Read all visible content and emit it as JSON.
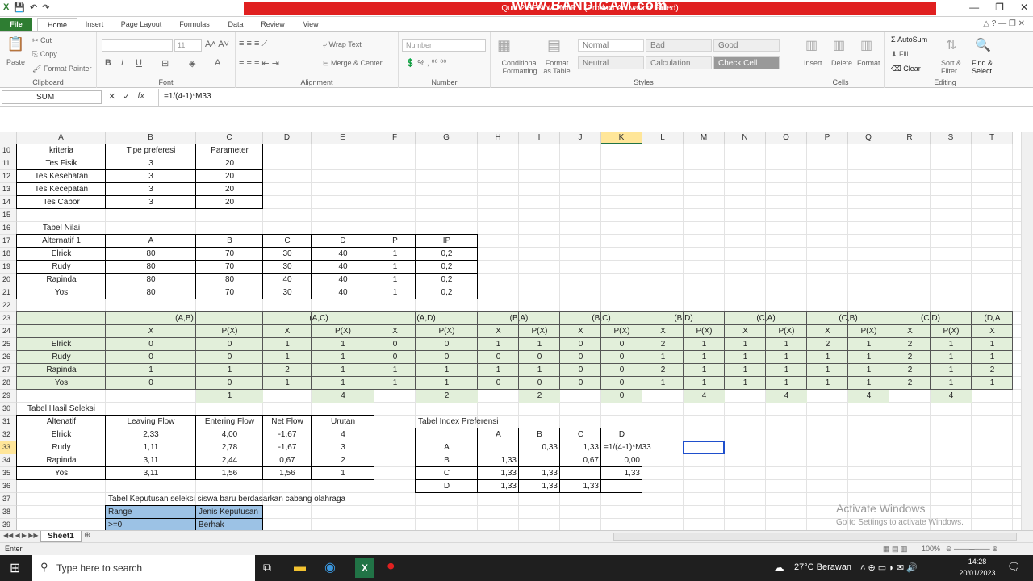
{
  "titlebar": {
    "title": "Quiz 2 SPK YATMI P... (Product Activation Failed)",
    "watermark": "www.BANDICAM.com",
    "qat": [
      "💾",
      "↶",
      "↷"
    ]
  },
  "tabs": [
    "File",
    "Home",
    "Insert",
    "Page Layout",
    "Formulas",
    "Data",
    "Review",
    "View"
  ],
  "ribbon": {
    "clipboard": {
      "paste": "Paste",
      "cut": "Cut",
      "copy": "Copy",
      "format_painter": "Format Painter",
      "label": "Clipboard"
    },
    "font": {
      "name": "",
      "size": "11",
      "label": "Font"
    },
    "alignment": {
      "wrap": "Wrap Text",
      "merge": "Merge & Center",
      "label": "Alignment"
    },
    "number": {
      "format": "Number",
      "label": "Number"
    },
    "styles": {
      "conditional": "Conditional Formatting",
      "format_table": "Format as Table",
      "normal": "Normal",
      "bad": "Bad",
      "good": "Good",
      "neutral": "Neutral",
      "calculation": "Calculation",
      "check_cell": "Check Cell",
      "label": "Styles"
    },
    "cells": {
      "insert": "Insert",
      "delete": "Delete",
      "format": "Format",
      "label": "Cells"
    },
    "editing": {
      "autosum": "AutoSum",
      "fill": "Fill",
      "clear": "Clear",
      "sort": "Sort & Filter",
      "find": "Find & Select",
      "label": "Editing"
    }
  },
  "formula_bar": {
    "name_box": "SUM",
    "formula": "=1/(4-1)*M33"
  },
  "columns": [
    "A",
    "B",
    "C",
    "D",
    "E",
    "F",
    "G",
    "H",
    "I",
    "J",
    "K",
    "L",
    "M",
    "N",
    "O",
    "P",
    "Q",
    "R",
    "S",
    "T"
  ],
  "rows": [
    "10",
    "11",
    "12",
    "13",
    "14",
    "15",
    "16",
    "17",
    "18",
    "19",
    "20",
    "21",
    "22",
    "23",
    "24",
    "25",
    "26",
    "27",
    "28",
    "29",
    "30",
    "31",
    "32",
    "33",
    "34",
    "35",
    "36",
    "37",
    "38",
    "39"
  ],
  "cells": {
    "kriteria": {
      "header": [
        "kriteria",
        "Tipe preferesi",
        "Parameter"
      ],
      "rows": [
        [
          "Tes Fisik",
          "3",
          "20"
        ],
        [
          "Tes Kesehatan",
          "3",
          "20"
        ],
        [
          "Tes Kecepatan",
          "3",
          "20"
        ],
        [
          "Tes Cabor",
          "3",
          "20"
        ]
      ]
    },
    "tabel_nilai": {
      "title": "Tabel Nilai",
      "header": [
        "Alternatif 1",
        "A",
        "B",
        "C",
        "D",
        "P",
        "IP"
      ],
      "rows": [
        [
          "Elrick",
          "80",
          "70",
          "30",
          "40",
          "1",
          "0,2"
        ],
        [
          "Rudy",
          "80",
          "70",
          "30",
          "40",
          "1",
          "0,2"
        ],
        [
          "Rapinda",
          "80",
          "80",
          "40",
          "40",
          "1",
          "0,2"
        ],
        [
          "Yos",
          "80",
          "70",
          "30",
          "40",
          "1",
          "0,2"
        ]
      ]
    },
    "pairs": [
      "(A,B)",
      "(A,C)",
      "(A,D)",
      "(B,A)",
      "(B,C)",
      "(B,D)",
      "(C,A)",
      "(C,B)",
      "(C,D)",
      "(D,A"
    ],
    "pair_sub": [
      "X",
      "P(X)",
      "X",
      "P(X)",
      "X",
      "P(X)",
      "X",
      "P(X)",
      "X",
      "P(X)",
      "X",
      "P(X)",
      "X",
      "P(X)",
      "X",
      "P(X)",
      "X",
      "P(X)",
      "X"
    ],
    "pair_names": [
      "Elrick",
      "Rudy",
      "Rapinda",
      "Yos"
    ],
    "pair_rows": [
      [
        "0",
        "0",
        "1",
        "1",
        "0",
        "0",
        "1",
        "1",
        "0",
        "0",
        "2",
        "1",
        "1",
        "1",
        "2",
        "1",
        "2",
        "1",
        "1"
      ],
      [
        "0",
        "0",
        "1",
        "1",
        "0",
        "0",
        "0",
        "0",
        "0",
        "0",
        "1",
        "1",
        "1",
        "1",
        "1",
        "1",
        "2",
        "1",
        "1"
      ],
      [
        "1",
        "1",
        "2",
        "1",
        "1",
        "1",
        "1",
        "1",
        "0",
        "0",
        "2",
        "1",
        "1",
        "1",
        "1",
        "1",
        "2",
        "1",
        "2"
      ],
      [
        "0",
        "0",
        "1",
        "1",
        "1",
        "1",
        "0",
        "0",
        "0",
        "0",
        "1",
        "1",
        "1",
        "1",
        "1",
        "1",
        "2",
        "1",
        "1"
      ]
    ],
    "pair_totals": [
      "1",
      "4",
      "2",
      "2",
      "0",
      "4",
      "4",
      "4",
      "4"
    ],
    "hasil": {
      "title": "Tabel Hasil Seleksi",
      "header": [
        "Altenatif",
        "Leaving Flow",
        "Entering Flow",
        "Net Flow",
        "Urutan"
      ],
      "rows": [
        [
          "Elrick",
          "2,33",
          "4,00",
          "-1,67",
          "4"
        ],
        [
          "Rudy",
          "1,11",
          "2,78",
          "-1,67",
          "3"
        ],
        [
          "Rapinda",
          "3,11",
          "2,44",
          "0,67",
          "2"
        ],
        [
          "Yos",
          "3,11",
          "1,56",
          "1,56",
          "1"
        ]
      ]
    },
    "index": {
      "title": "Tabel Index Preferensi",
      "header": [
        "A",
        "B",
        "C",
        "D"
      ],
      "labels": [
        "A",
        "B",
        "C",
        "D"
      ],
      "rows": [
        [
          "",
          "0,33",
          "1,33",
          "=1/(4-1)*M33"
        ],
        [
          "1,33",
          "",
          "0,67",
          "0,00"
        ],
        [
          "1,33",
          "1,33",
          "",
          "1,33"
        ],
        [
          "1,33",
          "1,33",
          "1,33",
          ""
        ]
      ]
    },
    "keputusan": {
      "title": "Tabel Keputusan seleksi siswa baru berdasarkan cabang olahraga",
      "header": [
        "Range",
        "Jenis Keputusan"
      ],
      "row": [
        ">=0",
        "Berhak"
      ]
    }
  },
  "sheet_tab": "Sheet1",
  "status": {
    "mode": "Enter",
    "zoom": "100%"
  },
  "activate": {
    "line1": "Activate Windows",
    "line2": "Go to Settings to activate Windows."
  },
  "taskbar": {
    "search": "Type here to search",
    "weather": "27°C  Berawan",
    "time": "14:28",
    "date": "20/01/2023"
  },
  "colors": {
    "file_tab": "#2e7d32",
    "title_red": "#e02020",
    "green_fill": "#e2efda",
    "blue_fill": "#9cc2e5"
  }
}
